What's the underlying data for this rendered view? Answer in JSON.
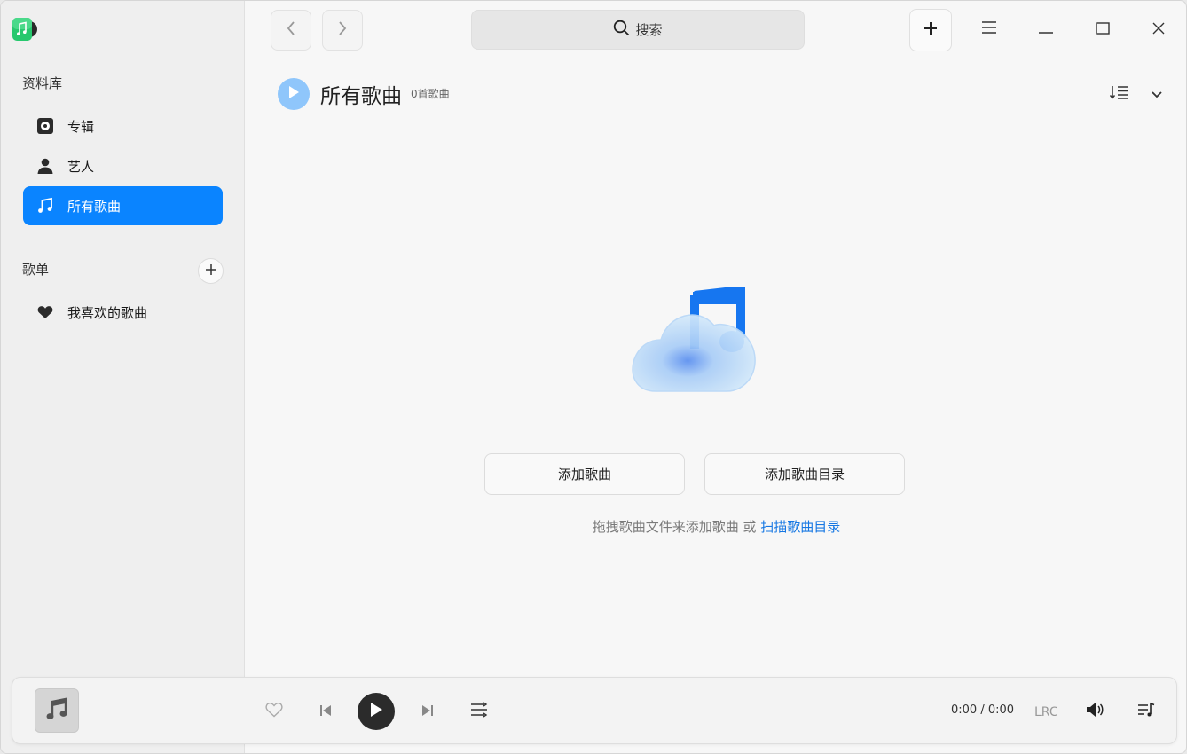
{
  "sidebar": {
    "library_title": "资料库",
    "library_items": [
      {
        "label": "专辑",
        "icon": "album-icon"
      },
      {
        "label": "艺人",
        "icon": "artist-icon"
      },
      {
        "label": "所有歌曲",
        "icon": "music-note-icon",
        "active": true
      }
    ],
    "playlists_title": "歌单",
    "playlists": [
      {
        "label": "我喜欢的歌曲",
        "icon": "heart-icon"
      }
    ]
  },
  "topbar": {
    "search_placeholder": "搜索"
  },
  "header": {
    "title": "所有歌曲",
    "count": "0首歌曲"
  },
  "empty_state": {
    "add_songs_label": "添加歌曲",
    "add_folder_label": "添加歌曲目录",
    "hint_text": "拖拽歌曲文件来添加歌曲 或 ",
    "hint_link": "扫描歌曲目录"
  },
  "player": {
    "time_current": "0:00",
    "time_separator": "/",
    "time_total": "0:00",
    "lrc_label": "LRC"
  },
  "colors": {
    "accent": "#0a84ff",
    "link": "#1677e3"
  }
}
